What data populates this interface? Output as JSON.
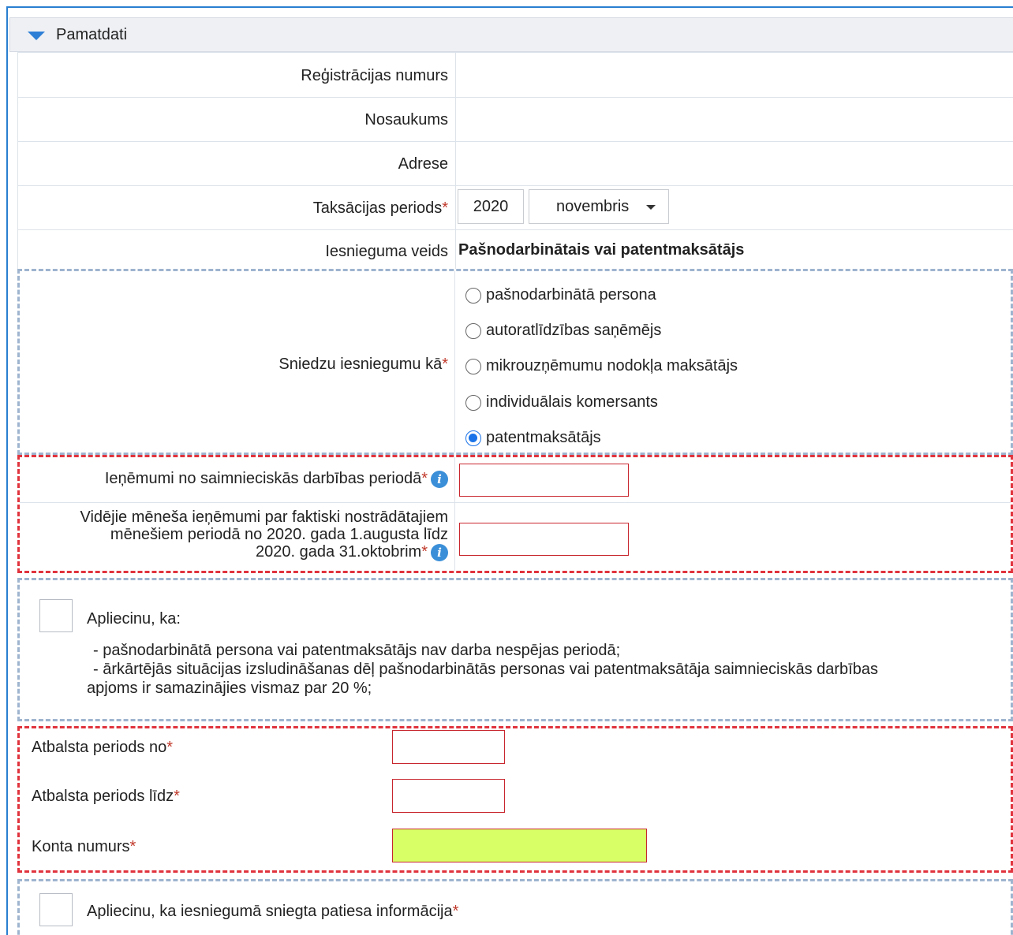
{
  "section": {
    "title": "Pamatdati"
  },
  "fields": {
    "reg_label": "Reģistrācijas numurs",
    "name_label": "Nosaukums",
    "address_label": "Adrese",
    "period_label": "Taksācijas periods",
    "period_year": "2020",
    "period_month": "novembris",
    "type_label": "Iesnieguma veids",
    "type_value": "Pašnodarbinātais vai patentmaksātājs",
    "submit_as_label": "Sniedzu iesniegumu kā",
    "required_mark": "*"
  },
  "radio_options": [
    {
      "label": "pašnodarbinātā persona",
      "checked": false
    },
    {
      "label": "autoratlīdzības saņēmējs",
      "checked": false
    },
    {
      "label": "mikrouzņēmumu nodokļa maksātājs",
      "checked": false
    },
    {
      "label": "individuālais komersants",
      "checked": false
    },
    {
      "label": "patentmaksātājs",
      "checked": true
    }
  ],
  "income": {
    "period_income_label": "Ieņēmumi no saimnieciskās darbības periodā",
    "avg_income_line1": "Vidējie mēneša ieņēmumi par faktiski nostrādātajiem",
    "avg_income_line2": "mēnešiem periodā no 2020. gada 1.augusta līdz",
    "avg_income_line3": "2020. gada 31.oktobrim",
    "info_glyph": "i"
  },
  "confirm1": {
    "title": "Apliecinu, ka:",
    "line1": "- pašnodarbinātā persona vai patentmaksātājs nav darba nespējas periodā;",
    "line2": "- ārkārtējās situācijas izsludināšanas dēļ pašnodarbinātās personas vai patentmaksātāja saimnieciskās darbības",
    "line3": "apjoms ir samazinājies vismaz par 20 %;"
  },
  "support": {
    "from_label": "Atbalsta periods no",
    "to_label": "Atbalsta periods līdz",
    "account_label": "Konta numurs"
  },
  "confirm2": {
    "text": "Apliecinu, ka iesniegumā sniegta patiesa informācija"
  },
  "colors": {
    "accent": "#2d7fd6",
    "required": "#c0392b",
    "error_border": "#e0333d",
    "highlight_input": "#d9ff66"
  }
}
